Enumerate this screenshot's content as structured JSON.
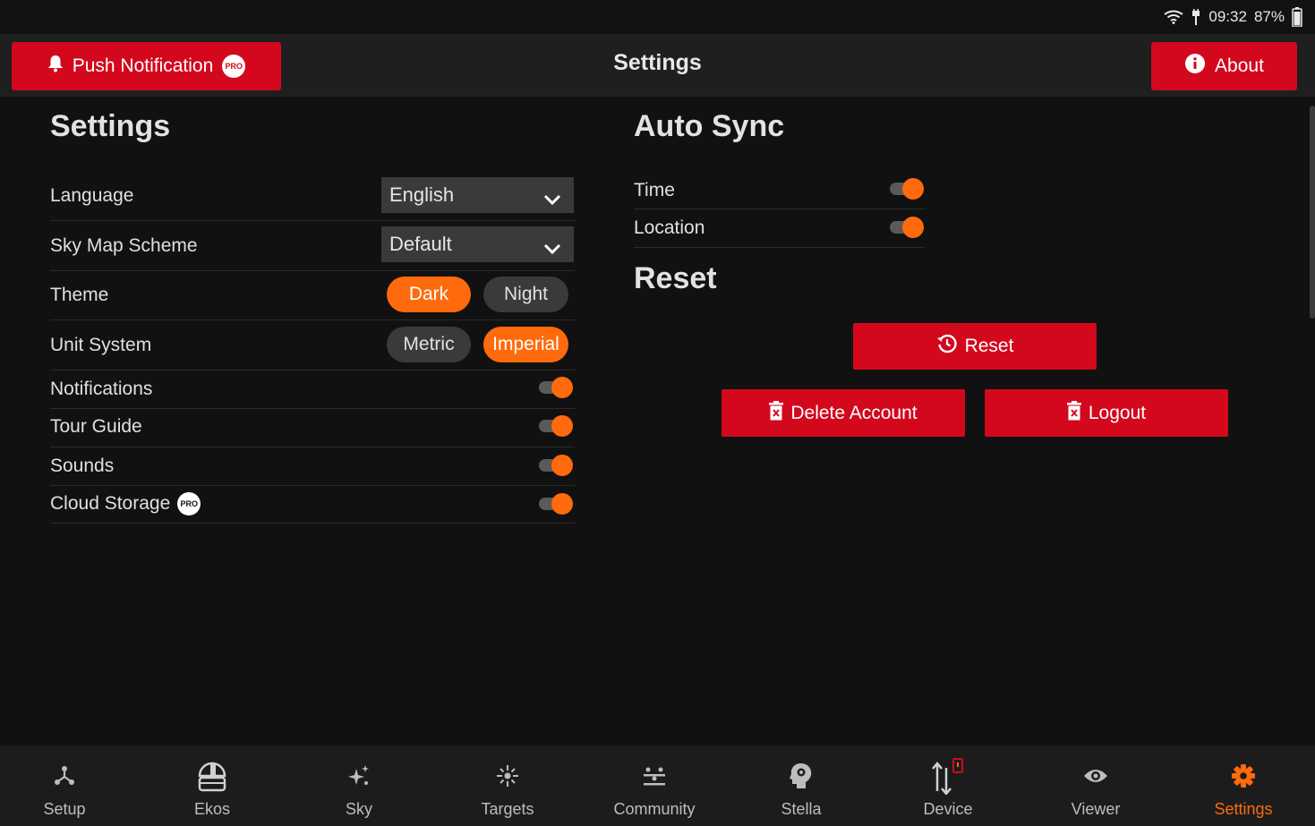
{
  "status_bar": {
    "time": "09:32",
    "battery": "87%"
  },
  "top_bar": {
    "title": "Settings",
    "push_label": "Push Notification",
    "pro_badge": "PRO",
    "about_label": "About"
  },
  "settings": {
    "heading": "Settings",
    "language": {
      "label": "Language",
      "value": "English"
    },
    "sky_map": {
      "label": "Sky Map Scheme",
      "value": "Default"
    },
    "theme": {
      "label": "Theme",
      "options": [
        "Dark",
        "Night"
      ],
      "selected": "Dark"
    },
    "units": {
      "label": "Unit System",
      "options": [
        "Metric",
        "Imperial"
      ],
      "selected": "Imperial"
    },
    "notifications": {
      "label": "Notifications",
      "on": true
    },
    "tour_guide": {
      "label": "Tour Guide",
      "on": true
    },
    "sounds": {
      "label": "Sounds",
      "on": true
    },
    "cloud_storage": {
      "label": "Cloud Storage",
      "pro": "PRO",
      "on": true
    }
  },
  "auto_sync": {
    "heading": "Auto Sync",
    "time": {
      "label": "Time",
      "on": true
    },
    "location": {
      "label": "Location",
      "on": true
    }
  },
  "reset": {
    "heading": "Reset",
    "reset_label": "Reset",
    "delete_label": "Delete Account",
    "logout_label": "Logout"
  },
  "bottom_nav": {
    "items": [
      {
        "label": "Setup",
        "icon": "setup-icon"
      },
      {
        "label": "Ekos",
        "icon": "observatory-dome-icon"
      },
      {
        "label": "Sky",
        "icon": "sparkle-stars-icon"
      },
      {
        "label": "Targets",
        "icon": "target-star-icon"
      },
      {
        "label": "Community",
        "icon": "people-icon"
      },
      {
        "label": "Stella",
        "icon": "head-gear-icon"
      },
      {
        "label": "Device",
        "icon": "device-transfer-icon"
      },
      {
        "label": "Viewer",
        "icon": "eye-icon"
      },
      {
        "label": "Settings",
        "icon": "gear-icon"
      }
    ],
    "active": "Settings"
  },
  "colors": {
    "accent": "#ff6a0d",
    "brand_red": "#d3081d",
    "background": "#111111"
  }
}
